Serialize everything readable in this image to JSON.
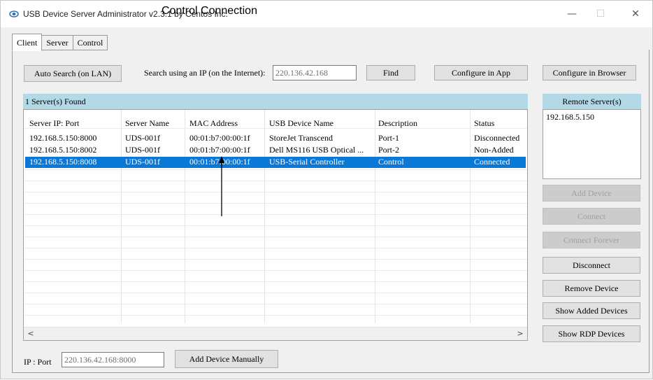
{
  "window": {
    "title": "USB Device Server Administrator v2.3.1 by Centos Inc.",
    "caption_overlay": "Control Connection",
    "controls": {
      "minimize": "—",
      "maximize": "☐",
      "close": "✕"
    }
  },
  "tabs": [
    {
      "label": "Client",
      "active": true
    },
    {
      "label": "Server",
      "active": false
    },
    {
      "label": "Control",
      "active": false
    }
  ],
  "toolbar": {
    "auto_search_label": "Auto Search (on LAN)",
    "search_ip_label": "Search using an IP (on the Internet):",
    "search_ip_value": "220.136.42.168",
    "find_label": "Find",
    "configure_app_label": "Configure in App",
    "configure_browser_label": "Configure in Browser"
  },
  "servers_found": "1 Server(s) Found",
  "table": {
    "headers": [
      "Server IP: Port",
      "Server Name",
      "MAC Address",
      "USB Device Name",
      "Description",
      "Status"
    ],
    "rows": [
      [
        "192.168.5.150:8000",
        "UDS-001f",
        "00:01:b7:00:00:1f",
        "StoreJet Transcend",
        "Port-1",
        "Disconnected"
      ],
      [
        "192.168.5.150:8002",
        "UDS-001f",
        "00:01:b7:00:00:1f",
        "Dell MS116 USB Optical ...",
        "Port-2",
        "Non-Added"
      ],
      [
        "192.168.5.150:8008",
        "UDS-001f",
        "00:01:b7:00:00:1f",
        "USB-Serial Controller",
        "Control",
        "Connected"
      ]
    ],
    "selected_row": 2,
    "scroll_left": "<",
    "scroll_right": ">"
  },
  "remote": {
    "header": "Remote Server(s)",
    "items": [
      "192.168.5.150"
    ]
  },
  "actions": {
    "add_device": "Add Device",
    "connect": "Connect",
    "connect_forever": "Connect Forever",
    "disconnect": "Disconnect",
    "remove_device": "Remove Device",
    "show_added_devices": "Show Added Devices",
    "show_rdp_devices": "Show RDP Devices"
  },
  "footer": {
    "ip_port_label": "IP : Port",
    "ip_port_value": "220.136.42.168:8000",
    "add_manually_label": "Add Device Manually"
  },
  "colors": {
    "selection": "#0a78d7",
    "header_bar": "#b3d8e6",
    "window_bg": "#f0f0f0"
  }
}
